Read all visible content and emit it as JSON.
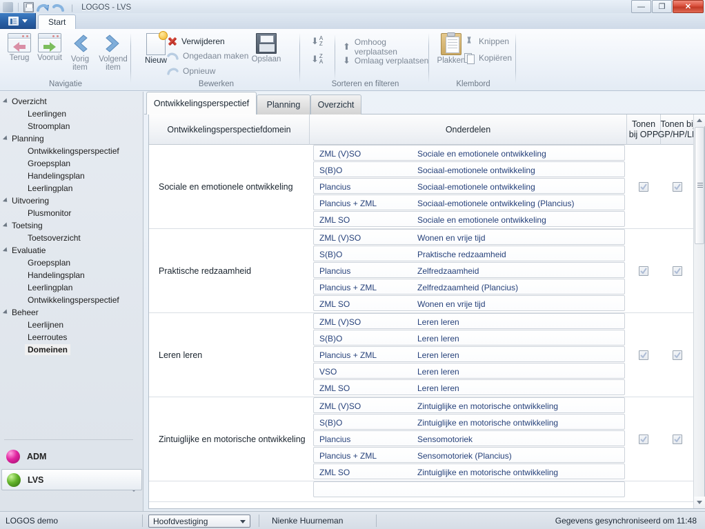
{
  "window": {
    "title": "LOGOS - LVS",
    "quick_access": [
      "logo-icon",
      "save-icon",
      "undo-icon",
      "redo-icon"
    ],
    "minimize": "—",
    "restore": "❐",
    "close": "✕"
  },
  "ribbon": {
    "app_menu": "app-menu-button",
    "tabs": [
      {
        "label": "Start",
        "active": true
      }
    ],
    "groups": [
      {
        "name": "Navigatie",
        "buttons": [
          {
            "label": "Terug",
            "enabled": false
          },
          {
            "label": "Vooruit",
            "enabled": false
          },
          {
            "label": "Vorig item",
            "enabled": false
          },
          {
            "label": "Volgend item",
            "enabled": false
          }
        ]
      },
      {
        "name": "Bewerken",
        "big_buttons": [
          {
            "label": "Nieuw",
            "enabled": true
          },
          {
            "label": "Opslaan",
            "enabled": false
          }
        ],
        "small_buttons": [
          {
            "label": "Verwijderen",
            "enabled": true
          },
          {
            "label": "Ongedaan maken",
            "enabled": false
          },
          {
            "label": "Opnieuw",
            "enabled": false
          }
        ]
      },
      {
        "name": "Sorteren en filteren",
        "sort_buttons": [
          "sort-ascending",
          "sort-descending"
        ],
        "small_buttons": [
          {
            "label": "Omhoog verplaatsen",
            "enabled": false
          },
          {
            "label": "Omlaag verplaatsen",
            "enabled": false
          }
        ]
      },
      {
        "name": "Klembord",
        "big_buttons": [
          {
            "label": "Plakken",
            "enabled": false
          }
        ],
        "small_buttons": [
          {
            "label": "Knippen",
            "enabled": false
          },
          {
            "label": "Kopiëren",
            "enabled": false
          }
        ]
      }
    ]
  },
  "sidebar": {
    "groups": [
      {
        "label": "Overzicht",
        "items": [
          "Leerlingen",
          "Stroomplan"
        ]
      },
      {
        "label": "Planning",
        "items": [
          "Ontwikkelingsperspectief",
          "Groepsplan",
          "Handelingsplan",
          "Leerlingplan"
        ]
      },
      {
        "label": "Uitvoering",
        "items": [
          "Plusmonitor"
        ]
      },
      {
        "label": "Toetsing",
        "items": [
          "Toetsoverzicht"
        ]
      },
      {
        "label": "Evaluatie",
        "items": [
          "Groepsplan",
          "Handelingsplan",
          "Leerlingplan",
          "Ontwikkelingsperspectief"
        ]
      },
      {
        "label": "Beheer",
        "items": [
          "Leerlijnen",
          "Leerroutes",
          "Domeinen"
        ]
      }
    ],
    "selected_item": "Domeinen",
    "modules": [
      {
        "label": "ADM",
        "color": "#e0239f",
        "active": false
      },
      {
        "label": "LVS",
        "color": "#63b32a",
        "active": true
      }
    ]
  },
  "content": {
    "tabs": [
      {
        "label": "Ontwikkelingsperspectief",
        "active": true
      },
      {
        "label": "Planning",
        "active": false
      },
      {
        "label": "Overzicht",
        "active": false
      }
    ],
    "grid": {
      "headers": {
        "domain": "Ontwikkelingsperspectiefdomein",
        "parts": "Onderdelen",
        "show_opp": "Tonen bij OPP",
        "show_gp": "Tonen bij GP/HP/LP"
      },
      "rows": [
        {
          "domain": "Sociale en emotionele ontwikkeling",
          "show_opp": true,
          "show_gp": true,
          "parts": [
            {
              "code": "ZML (V)SO",
              "name": "Sociale en emotionele ontwikkeling"
            },
            {
              "code": "S(B)O",
              "name": "Sociaal-emotionele ontwikkeling"
            },
            {
              "code": "Plancius",
              "name": "Sociaal-emotionele ontwikkeling"
            },
            {
              "code": "Plancius + ZML",
              "name": "Sociaal-emotionele ontwikkeling (Plancius)"
            },
            {
              "code": "ZML SO",
              "name": "Sociale en emotionele ontwikkeling"
            }
          ]
        },
        {
          "domain": "Praktische redzaamheid",
          "show_opp": true,
          "show_gp": true,
          "parts": [
            {
              "code": "ZML (V)SO",
              "name": "Wonen en vrije tijd"
            },
            {
              "code": "S(B)O",
              "name": "Praktische redzaamheid"
            },
            {
              "code": "Plancius",
              "name": "Zelfredzaamheid"
            },
            {
              "code": "Plancius + ZML",
              "name": "Zelfredzaamheid (Plancius)"
            },
            {
              "code": "ZML SO",
              "name": "Wonen en vrije tijd"
            }
          ]
        },
        {
          "domain": "Leren leren",
          "show_opp": true,
          "show_gp": true,
          "parts": [
            {
              "code": "ZML (V)SO",
              "name": "Leren leren"
            },
            {
              "code": "S(B)O",
              "name": "Leren leren"
            },
            {
              "code": "Plancius + ZML",
              "name": "Leren leren"
            },
            {
              "code": "VSO",
              "name": "Leren leren"
            },
            {
              "code": "ZML SO",
              "name": "Leren leren"
            }
          ]
        },
        {
          "domain": "Zintuiglijke en motorische ontwikkeling",
          "show_opp": true,
          "show_gp": true,
          "parts": [
            {
              "code": "ZML (V)SO",
              "name": "Zintuiglijke en motorische ontwikkeling"
            },
            {
              "code": "S(B)O",
              "name": "Zintuiglijke en motorische ontwikkeling"
            },
            {
              "code": "Plancius",
              "name": "Sensomotoriek"
            },
            {
              "code": "Plancius + ZML",
              "name": "Sensomotoriek (Plancius)"
            },
            {
              "code": "ZML SO",
              "name": "Zintuiglijke en motorische ontwikkeling"
            }
          ]
        }
      ]
    }
  },
  "status": {
    "app_label": "LOGOS demo",
    "location": "Hoofdvestiging",
    "user": "Nienke Huurneman",
    "sync": "Gegevens gesynchroniseerd om 11:48"
  }
}
